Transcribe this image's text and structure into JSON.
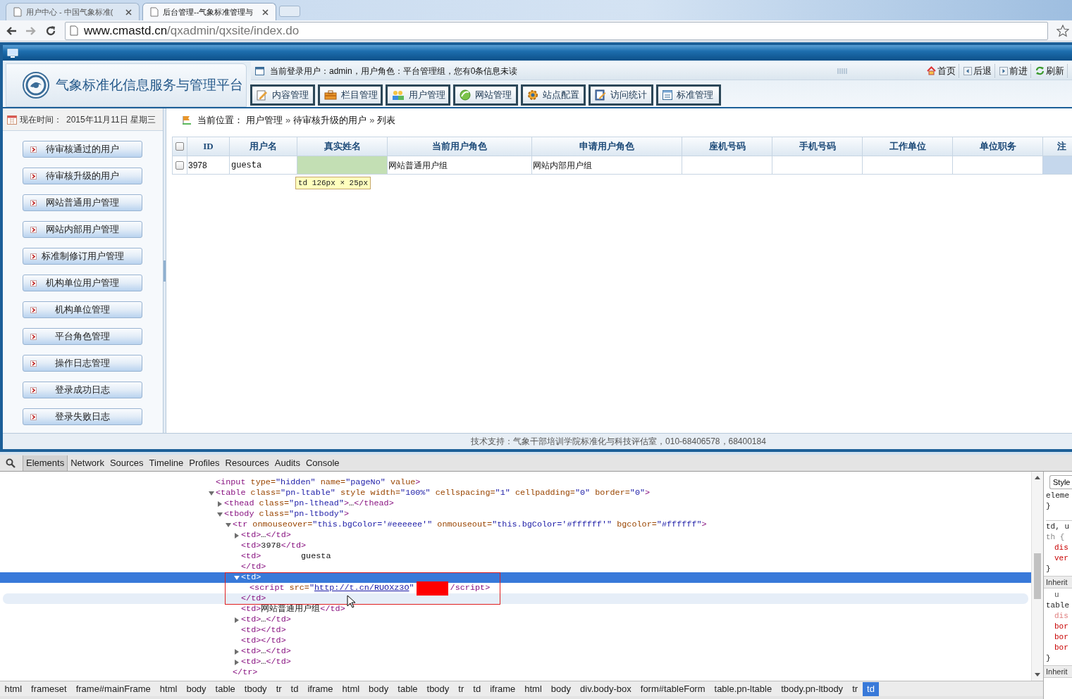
{
  "browser": {
    "tabs": [
      {
        "title": "用户中心 - 中国气象标准(",
        "selected": false
      },
      {
        "title": "后台管理--气象标准管理与",
        "selected": true
      }
    ],
    "address": {
      "host": "www.cmastd.cn",
      "path": "/qxadmin/qxsite/index.do"
    }
  },
  "header": {
    "title": "气象标准化信息服务与管理平台",
    "login_info": "当前登录用户：admin，用户角色：平台管理组，您有0条信息未读",
    "links": [
      "首页",
      "后退",
      "前进",
      "刷新"
    ],
    "nav_tabs": [
      "内容管理",
      "栏目管理",
      "用户管理",
      "网站管理",
      "站点配置",
      "访问统计",
      "标准管理"
    ]
  },
  "sidebar": {
    "time_label": "现在时间：",
    "date": "2015年11月11日 星期三",
    "items": [
      "待审核通过的用户",
      "待审核升级的用户",
      "网站普通用户管理",
      "网站内部用户管理",
      "标准制修订用户管理",
      "机构单位用户管理",
      "机构单位管理",
      "平台角色管理",
      "操作日志管理",
      "登录成功日志",
      "登录失败日志"
    ]
  },
  "breadcrumb": {
    "label": "当前位置：",
    "path": [
      "用户管理",
      "待审核升级的用户",
      "列表"
    ],
    "separator": "»"
  },
  "table": {
    "select_all_checked": false,
    "columns": [
      "ID",
      "用户名",
      "真实姓名",
      "当前用户角色",
      "申请用户角色",
      "座机号码",
      "手机号码",
      "工作单位",
      "单位职务",
      "注"
    ],
    "rows": [
      {
        "checked": false,
        "cells": [
          {
            "text": "3978"
          },
          {
            "text": "guesta",
            "mono": true
          },
          {
            "inspected": true
          },
          {
            "text": "网站普通用户组"
          },
          {
            "text": "网站内部用户组"
          },
          {},
          {},
          {},
          {},
          {
            "hovered": true
          }
        ]
      }
    ],
    "tooltip": "td 126px × 25px"
  },
  "footer": "技术支持：气象干部培训学院标准化与科技评估室，010-68406578，68400184",
  "devtools": {
    "tabs": [
      {
        "label": "Elements",
        "selected": true
      },
      {
        "label": "Network",
        "selected": false
      },
      {
        "label": "Sources",
        "selected": false
      },
      {
        "label": "Timeline",
        "selected": false
      },
      {
        "label": "Profiles",
        "selected": false
      },
      {
        "label": "Resources",
        "selected": false
      },
      {
        "label": "Audits",
        "selected": false
      },
      {
        "label": "Console",
        "selected": false
      }
    ],
    "dom": [
      {
        "text": "<input type=\"hidden\" name=\"pageNo\" value>",
        "selected": false
      },
      {
        "text": "<table class=\"pn-ltable\" style width=\"100%\" cellspacing=\"1\" cellpadding=\"0\" border=\"0\">",
        "expanded": true,
        "selected": false,
        "children": [
          {
            "text": "<thead class=\"pn-lthead\">…</thead>",
            "expanded": false,
            "selected": false
          },
          {
            "text": "<tbody class=\"pn-ltbody\">",
            "expanded": true,
            "selected": false,
            "children": [
              {
                "text": "<tr onmouseover=\"this.bgColor='#eeeeee'\" onmouseout=\"this.bgColor='#ffffff'\" bgcolor=\"#ffffff\">",
                "expanded": true,
                "selected": false,
                "close": "</tr>",
                "children": [
                  {
                    "text": "<td>…</td>",
                    "expanded": false,
                    "selected": false
                  },
                  {
                    "text": "<td>3978</td>",
                    "selected": false
                  },
                  {
                    "text": "<td>        guesta",
                    "selected": false,
                    "close": "</td>"
                  },
                  {
                    "text": "<td>",
                    "expanded": true,
                    "selected": true,
                    "annotated": true,
                    "close": "</td>",
                    "close_hovered": true,
                    "children": [
                      {
                        "selected": false,
                        "parts": [
                          {
                            "kind": "tag",
                            "text": "<script"
                          },
                          {
                            "kind": "attr",
                            "text": "src="
                          },
                          {
                            "kind": "value",
                            "text": "\""
                          },
                          {
                            "kind": "link",
                            "text": "http://t.cn/RUOXz3O"
                          },
                          {
                            "kind": "value",
                            "text": "\""
                          },
                          {
                            "kind": "redaction"
                          },
                          {
                            "kind": "tag",
                            "text": "/script>"
                          }
                        ]
                      }
                    ]
                  },
                  {
                    "text": "<td>网站普通用户组</td>",
                    "selected": false
                  },
                  {
                    "text": "<td>…</td>",
                    "expanded": false,
                    "selected": false
                  },
                  {
                    "text": "<td></td>",
                    "selected": false
                  },
                  {
                    "text": "<td></td>",
                    "selected": false
                  },
                  {
                    "text": "<td>…</td>",
                    "expanded": false,
                    "selected": false
                  },
                  {
                    "text": "<td>…</td>",
                    "expanded": false,
                    "selected": false
                  }
                ]
              }
            ]
          }
        ]
      }
    ],
    "path": [
      {
        "label": "html",
        "selected": false
      },
      {
        "label": "frameset",
        "selected": false
      },
      {
        "label": "frame#mainFrame",
        "selected": false
      },
      {
        "label": "html",
        "selected": false
      },
      {
        "label": "body",
        "selected": false
      },
      {
        "label": "table",
        "selected": false
      },
      {
        "label": "tbody",
        "selected": false
      },
      {
        "label": "tr",
        "selected": false
      },
      {
        "label": "td",
        "selected": false
      },
      {
        "label": "iframe",
        "selected": false
      },
      {
        "label": "html",
        "selected": false
      },
      {
        "label": "body",
        "selected": false
      },
      {
        "label": "table",
        "selected": false
      },
      {
        "label": "tbody",
        "selected": false
      },
      {
        "label": "tr",
        "selected": false
      },
      {
        "label": "td",
        "selected": false
      },
      {
        "label": "iframe",
        "selected": false
      },
      {
        "label": "html",
        "selected": false
      },
      {
        "label": "body",
        "selected": false
      },
      {
        "label": "div.body-box",
        "selected": false
      },
      {
        "label": "form#tableForm",
        "selected": false
      },
      {
        "label": "table.pn-ltable",
        "selected": false
      },
      {
        "label": "tbody.pn-ltbody",
        "selected": false
      },
      {
        "label": "tr",
        "selected": false
      },
      {
        "label": "td",
        "selected": true
      }
    ],
    "styles": [
      {
        "kind": "tab",
        "text": "Style"
      },
      {
        "kind": "selector",
        "text": "eleme"
      },
      {
        "kind": "brace",
        "text": "}"
      },
      {
        "kind": "selector",
        "text": "td, u",
        "rule_start": true
      },
      {
        "kind": "ua_selector",
        "text": "th {"
      },
      {
        "kind": "property",
        "text": "dis"
      },
      {
        "kind": "property",
        "text": "ver"
      },
      {
        "kind": "brace",
        "text": "}"
      },
      {
        "kind": "section",
        "text": "Inherit"
      },
      {
        "kind": "source",
        "text": "u"
      },
      {
        "kind": "selector",
        "text": "table"
      },
      {
        "kind": "overridden",
        "text": "dis"
      },
      {
        "kind": "property",
        "text": "bor"
      },
      {
        "kind": "property",
        "text": "bor"
      },
      {
        "kind": "property",
        "text": "bor"
      },
      {
        "kind": "brace",
        "text": "}"
      },
      {
        "kind": "section",
        "text": "Inherit"
      }
    ]
  }
}
